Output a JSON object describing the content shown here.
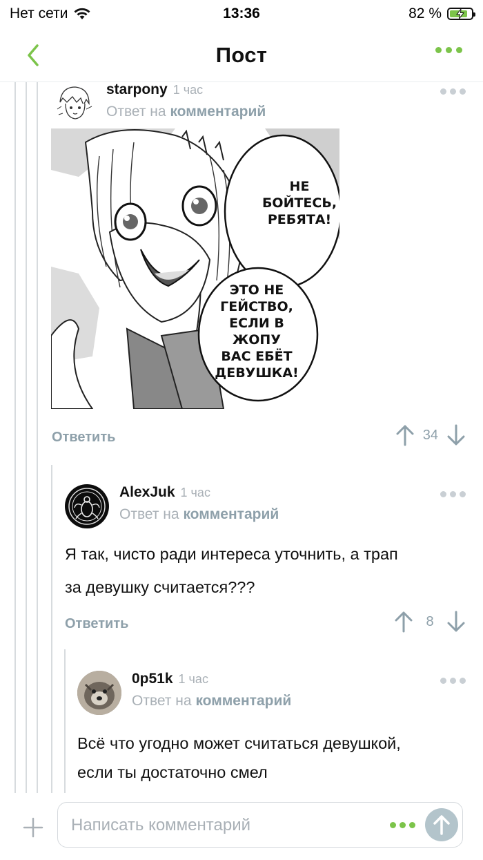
{
  "status": {
    "carrier": "Нет сети",
    "time": "13:36",
    "battery_percent": "82 %",
    "battery_level": 0.82,
    "battery_color": "#7cc44a"
  },
  "nav": {
    "title": "Пост",
    "back_icon": "chevron-left-icon",
    "more_icon": "more-dots-icon",
    "accent": "#7cc44a"
  },
  "comments": [
    {
      "author": "starpony",
      "time": "1 час",
      "reply_prefix": "Ответ на",
      "reply_link": "комментарий",
      "image_text": [
        "НЕ",
        "БОЙТЕСЬ,",
        "РЕБЯТА!",
        "ЭТО НЕ",
        "ГЕЙСТВО,",
        "ЕСЛИ В",
        "ЖОПУ",
        "ВАС ЕБЁТ",
        "ДЕВУШКА!"
      ],
      "reply_label": "Ответить",
      "rating": "34"
    },
    {
      "author": "AlexJuk",
      "time": "1 час",
      "reply_prefix": "Ответ на",
      "reply_link": "комментарий",
      "text_lines": [
        "Я так, чисто ради интереса уточнить, а трап",
        "за девушку считается???"
      ],
      "reply_label": "Ответить",
      "rating": "8"
    },
    {
      "author": "0p51k",
      "time": "1 час",
      "reply_prefix": "Ответ на",
      "reply_link": "комментарий",
      "text_lines": [
        "Всё что угодно может считаться девушкой,",
        "если ты достаточно смел"
      ]
    }
  ],
  "composer": {
    "placeholder": "Написать комментарий"
  }
}
